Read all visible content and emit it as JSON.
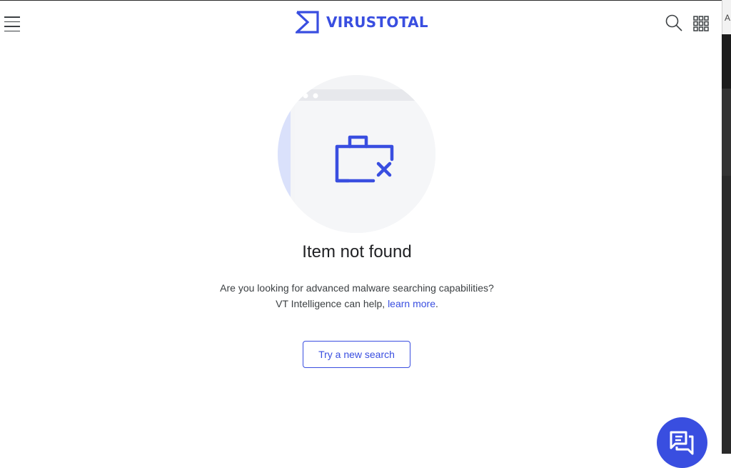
{
  "header": {
    "brand_name": "VIRUSTOTAL",
    "menu_icon": "hamburger-menu-icon",
    "search_icon": "search-icon",
    "apps_icon": "apps-grid-icon",
    "logo_icon": "virustotal-sigma-logo-icon"
  },
  "main": {
    "illustration_icon": "folder-not-found-icon",
    "title": "Item not found",
    "description_line1": "Are you looking for advanced malware searching capabilities?",
    "description_line2_prefix": "VT Intelligence can help, ",
    "learn_more_link": "learn more",
    "description_line2_suffix": ".",
    "try_button_label": "Try a new search"
  },
  "chat": {
    "icon": "chat-bubbles-icon"
  },
  "background_app": {
    "visible_letter": "A"
  },
  "colors": {
    "accent": "#394ee0",
    "text_primary": "#202124",
    "text_secondary": "#3c4043",
    "illustration_circle": "#f3f4f6",
    "illustration_left_tint": "#d9e0fb"
  }
}
